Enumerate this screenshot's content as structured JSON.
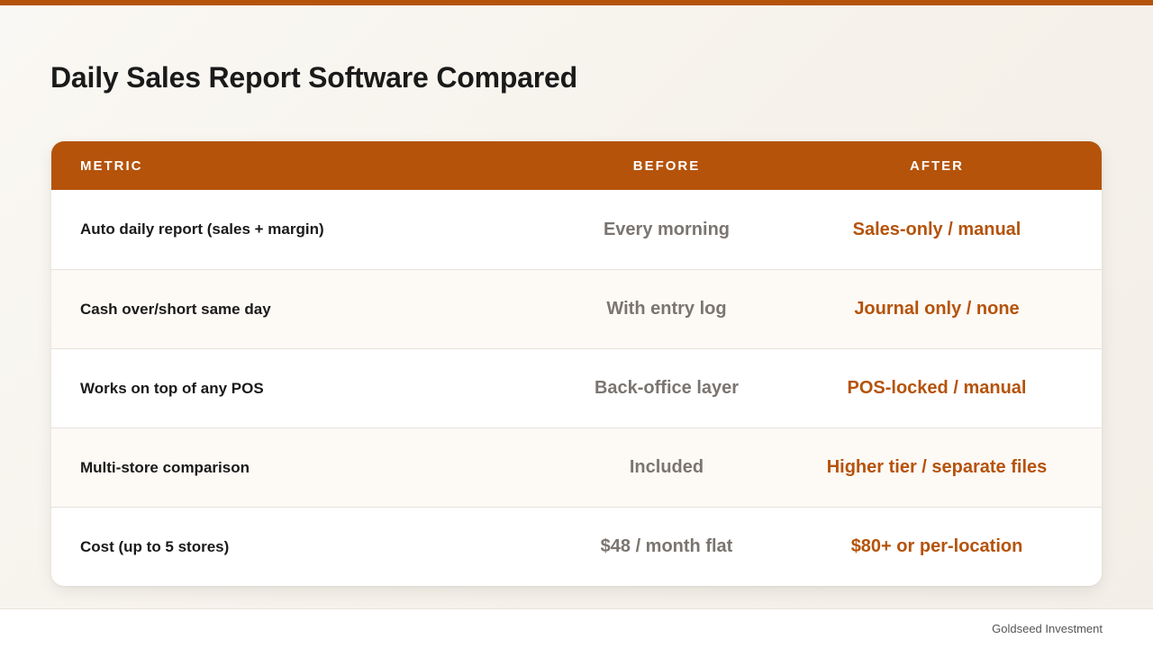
{
  "colors": {
    "accent": "#b5530b",
    "before_text": "#7a7570",
    "title_text": "#1a1a1a"
  },
  "page": {
    "title": "Daily Sales Report Software Compared"
  },
  "table": {
    "headers": {
      "metric": "METRIC",
      "before": "BEFORE",
      "after": "AFTER"
    },
    "rows": [
      {
        "metric": "Auto daily report (sales + margin)",
        "before": "Every morning",
        "after": "Sales-only / manual"
      },
      {
        "metric": "Cash over/short same day",
        "before": "With entry log",
        "after": "Journal only / none"
      },
      {
        "metric": "Works on top of any POS",
        "before": "Back-office layer",
        "after": "POS-locked / manual"
      },
      {
        "metric": "Multi-store comparison",
        "before": "Included",
        "after": "Higher tier / separate files"
      },
      {
        "metric": "Cost (up to 5 stores)",
        "before": "$48 / month flat",
        "after": "$80+ or per-location"
      }
    ]
  },
  "footer": {
    "brand": "Goldseed Investment"
  }
}
